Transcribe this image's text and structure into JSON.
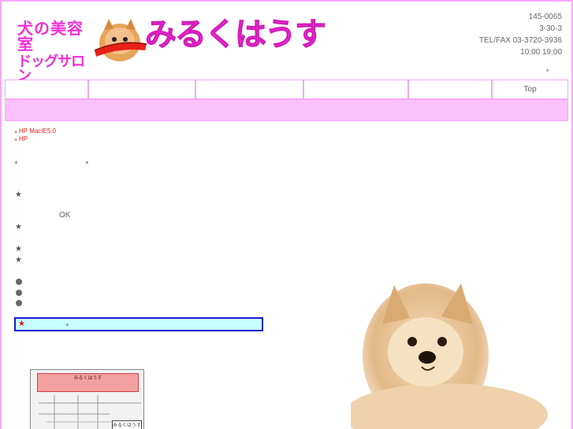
{
  "header": {
    "logo_line1": "犬の美容室",
    "logo_line2": "ドッグサロン",
    "logo_main": "みるくはうす",
    "postal": "145-0065",
    "address": "3-30-3",
    "tel": "TEL/FAX 03-3720-3936",
    "hours": "10:00 19:00",
    "close_mark": "⁎"
  },
  "nav": {
    "items": [
      {
        "label": ""
      },
      {
        "label": ""
      },
      {
        "label": ""
      },
      {
        "label": ""
      },
      {
        "label": ""
      },
      {
        "label": "Top"
      }
    ]
  },
  "notices": [
    {
      "mark": "⁎",
      "text": "HP MacIE5.0"
    },
    {
      "mark": "⁎",
      "text": "HP"
    }
  ],
  "content": {
    "cross1": "⁎",
    "cross2": "⁎",
    "star": "★",
    "ok": "OK",
    "info_star": "★",
    "info_cross": "⁎"
  },
  "map": {
    "title": "みるくはうす",
    "label": "みるくはうす"
  },
  "colors": {
    "accent_pink": "#f02fd8",
    "border_pink": "#f7a8f7",
    "band_pink": "#fcc0fb",
    "info_bg": "#c8ffff",
    "info_border": "#1a1ad0",
    "notice_red": "#e02020"
  }
}
